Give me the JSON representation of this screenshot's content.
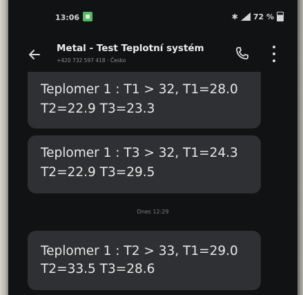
{
  "status_bar": {
    "time": "13:06",
    "battery": "72 %",
    "icons": [
      "app-notification-icon",
      "bluetooth-icon",
      "signal-icon",
      "battery-icon"
    ]
  },
  "header": {
    "contact_name": "Metal - Test Teplotní systém",
    "contact_sub": "+420 732 597 418 · Česko",
    "back_icon": "arrow-left-icon",
    "call_icon": "phone-icon",
    "more_icon": "more-vertical-icon"
  },
  "messages": [
    {
      "line1": "Teplomer 1 : T1 > 32, T1=28.0",
      "line2": "T2=22.9 T3=23.3"
    },
    {
      "line1": "Teplomer 1 : T3 > 32, T1=24.3",
      "line2": "T2=22.9 T3=29.5"
    },
    {
      "line1": "Teplomer 1 : T2 > 33, T1=29.0",
      "line2": "T2=33.5 T3=28.6"
    }
  ],
  "date_separator": "Dnes 12:29",
  "colors": {
    "background": "#111214",
    "bubble": "#2f3033",
    "text": "#e8e8e8",
    "notification_accent": "#59b765"
  }
}
